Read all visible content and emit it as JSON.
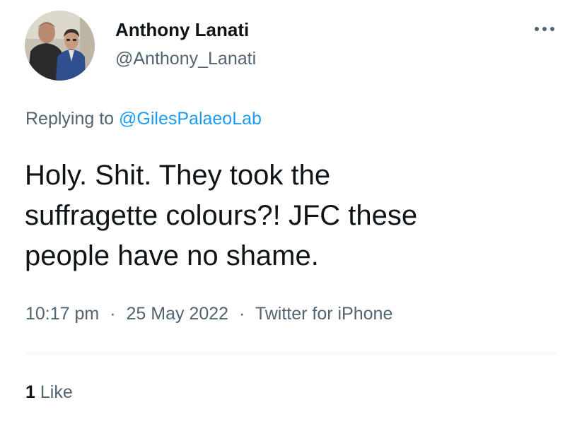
{
  "author": {
    "display_name": "Anthony Lanati",
    "handle": "@Anthony_Lanati",
    "avatar": "profile-photo"
  },
  "reply": {
    "prefix": "Replying to",
    "target": "@GilesPalaeoLab"
  },
  "tweet": {
    "lines": [
      "Holy. Shit. They took the",
      "suffragette colours?! JFC these",
      "people have no shame."
    ]
  },
  "meta": {
    "time": "10:17 pm",
    "date": "25 May 2022",
    "source": "Twitter for iPhone",
    "separator": "·"
  },
  "stats": {
    "like_count": "1",
    "like_label": "Like"
  },
  "icons": {
    "more": "more-horizontal-icon"
  },
  "colors": {
    "text_primary": "#0f1419",
    "text_secondary": "#536471",
    "link": "#1d9bf0",
    "divider": "#eff3f4"
  }
}
